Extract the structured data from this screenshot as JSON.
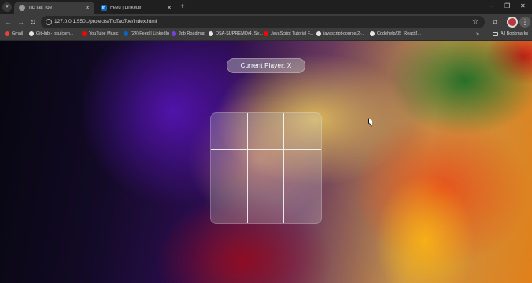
{
  "browser": {
    "tabs": [
      {
        "title": "Tic Tac Toe",
        "active": true
      },
      {
        "title": "Feed | LinkedIn",
        "active": false
      }
    ],
    "url": "127.0.0.1:5501/projects/TicTacToe/index.html",
    "bookmarks": [
      {
        "label": "Gmail",
        "icon": "gmail-icon"
      },
      {
        "label": "GitHub - osu/com...",
        "icon": "github-icon"
      },
      {
        "label": "YouTube Music",
        "icon": "youtube-music-icon"
      },
      {
        "label": "(24) Feed | LinkedIn",
        "icon": "linkedin-icon"
      },
      {
        "label": "Job Roadmap",
        "icon": "roadmap-icon"
      },
      {
        "label": "DSA-SUPREMO/4. Se...",
        "icon": "github-icon"
      },
      {
        "label": "JavaScript Tutorial F...",
        "icon": "youtube-icon"
      },
      {
        "label": "javascript-course/2-...",
        "icon": "github-icon"
      },
      {
        "label": "Codehelp/05_ReactJ...",
        "icon": "github-icon"
      }
    ],
    "all_bookmarks_label": "All Bookmarks",
    "more_symbol": "»"
  },
  "game": {
    "status_text": "Current Player: X",
    "cells": [
      "",
      "",
      "",
      "",
      "",
      "",
      "",
      "",
      ""
    ]
  },
  "colors": {
    "tabstrip": "#1f1f1f",
    "toolbar": "#3c3c3c",
    "omnibox": "#282828"
  }
}
